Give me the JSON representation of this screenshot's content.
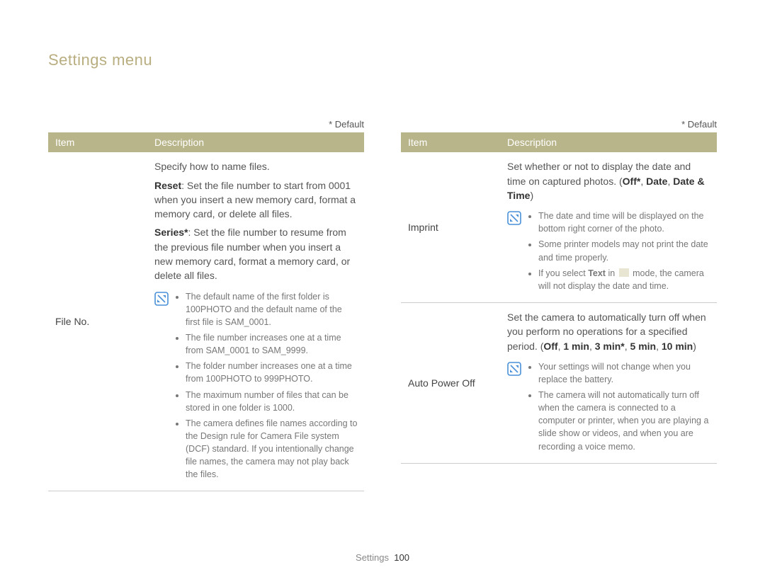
{
  "title": "Settings menu",
  "defaultNote": "* Default",
  "headers": {
    "item": "Item",
    "desc": "Description"
  },
  "left": {
    "item": "File No.",
    "intro_plain": "Specify how to name files.",
    "reset_label": "Reset",
    "reset_text": ": Set the file number to start from 0001 when you insert a new memory card, format a memory card, or delete all files.",
    "series_label": "Series*",
    "series_text": ": Set the file number to resume from the previous file number when you insert a new memory card, format a memory card, or delete all files.",
    "notes": [
      "The default name of the first folder is 100PHOTO and the default name of the first file is SAM_0001.",
      "The file number increases one at a time from SAM_0001 to SAM_9999.",
      "The folder number increases one at a time from 100PHOTO to 999PHOTO.",
      "The maximum number of files that can be stored in one folder is 1000.",
      "The camera defines file names according to the Design rule for Camera File system (DCF) standard. If you intentionally change file names, the camera may not play back the files."
    ]
  },
  "right": {
    "imprint": {
      "item": "Imprint",
      "intro_pre": "Set whether or not to display the date and time on captured photos. (",
      "off": "Off*",
      "sep": ", ",
      "date": "Date",
      "datetime": "Date & Time",
      "intro_post": ")",
      "notes": [
        "The date and time will be displayed on the bottom right corner of the photo.",
        "Some printer models may not print the date and time properly."
      ],
      "note3_pre": "If you select ",
      "note3_bold": "Text",
      "note3_mid": " in ",
      "note3_post": " mode, the camera will not display the date and time."
    },
    "apo": {
      "item": "Auto Power Off",
      "intro_pre": "Set the camera to automatically turn off when you perform no operations for a specified period. (",
      "off": "Off",
      "sep": ", ",
      "o1": "1 min",
      "o2": "3 min*",
      "o3": "5 min",
      "o4": "10 min",
      "intro_post": ")",
      "notes": [
        "Your settings will not change when you replace the battery.",
        "The camera will not automatically turn off when the camera is connected to a computer or printer, when you are playing a slide show or videos, and when you are recording a voice memo."
      ]
    }
  },
  "footer": {
    "section": "Settings",
    "page": "100"
  }
}
